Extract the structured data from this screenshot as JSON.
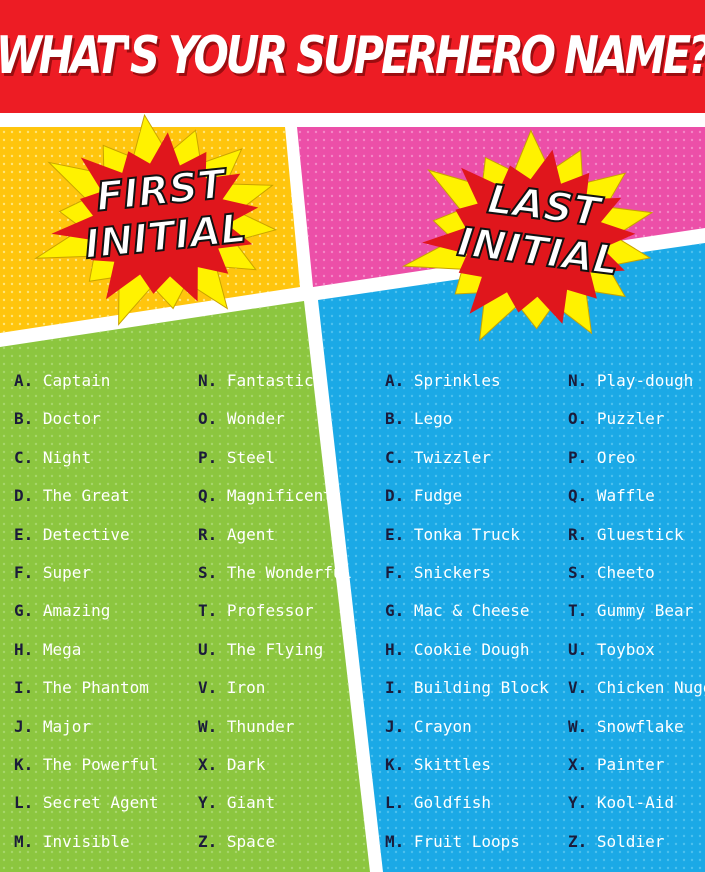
{
  "title": "WHAT'S YOUR SUPERHERO NAME?",
  "first_badge": {
    "line1": "FIRST",
    "line2": "INITIAL"
  },
  "last_badge": {
    "line1": "LAST",
    "line2": "INITIAL"
  },
  "colors": {
    "header": "#ed1c24",
    "first_panel": "#ffc50d",
    "last_panel": "#ec4fa8",
    "first_list_bg": "#8cc63f",
    "last_list_bg": "#1ba9e6",
    "burst_outer": "#fff200",
    "burst_inner": "#e0161c",
    "letter": "#1b1b3a"
  },
  "first_names": [
    {
      "letter": "A.",
      "word": "Captain"
    },
    {
      "letter": "B.",
      "word": "Doctor"
    },
    {
      "letter": "C.",
      "word": "Night"
    },
    {
      "letter": "D.",
      "word": "The Great"
    },
    {
      "letter": "E.",
      "word": "Detective"
    },
    {
      "letter": "F.",
      "word": "Super"
    },
    {
      "letter": "G.",
      "word": "Amazing"
    },
    {
      "letter": "H.",
      "word": "Mega"
    },
    {
      "letter": "I.",
      "word": "The Phantom"
    },
    {
      "letter": "J.",
      "word": "Major"
    },
    {
      "letter": "K.",
      "word": "The Powerful"
    },
    {
      "letter": "L.",
      "word": "Secret Agent"
    },
    {
      "letter": "M.",
      "word": "Invisible"
    },
    {
      "letter": "N.",
      "word": "Fantastic"
    },
    {
      "letter": "O.",
      "word": "Wonder"
    },
    {
      "letter": "P.",
      "word": "Steel"
    },
    {
      "letter": "Q.",
      "word": "Magnificent"
    },
    {
      "letter": "R.",
      "word": "Agent"
    },
    {
      "letter": "S.",
      "word": "The Wonderful"
    },
    {
      "letter": "T.",
      "word": "Professor"
    },
    {
      "letter": "U.",
      "word": "The Flying"
    },
    {
      "letter": "V.",
      "word": "Iron"
    },
    {
      "letter": "W.",
      "word": "Thunder"
    },
    {
      "letter": "X.",
      "word": "Dark"
    },
    {
      "letter": "Y.",
      "word": "Giant"
    },
    {
      "letter": "Z.",
      "word": "Space"
    }
  ],
  "last_names": [
    {
      "letter": "A.",
      "word": "Sprinkles"
    },
    {
      "letter": "B.",
      "word": "Lego"
    },
    {
      "letter": "C.",
      "word": "Twizzler"
    },
    {
      "letter": "D.",
      "word": "Fudge"
    },
    {
      "letter": "E.",
      "word": "Tonka Truck"
    },
    {
      "letter": "F.",
      "word": "Snickers"
    },
    {
      "letter": "G.",
      "word": "Mac & Cheese"
    },
    {
      "letter": "H.",
      "word": "Cookie Dough"
    },
    {
      "letter": "I.",
      "word": "Building Block"
    },
    {
      "letter": "J.",
      "word": "Crayon"
    },
    {
      "letter": "K.",
      "word": "Skittles"
    },
    {
      "letter": "L.",
      "word": "Goldfish"
    },
    {
      "letter": "M.",
      "word": "Fruit Loops"
    },
    {
      "letter": "N.",
      "word": "Play-dough"
    },
    {
      "letter": "O.",
      "word": "Puzzler"
    },
    {
      "letter": "P.",
      "word": "Oreo"
    },
    {
      "letter": "Q.",
      "word": "Waffle"
    },
    {
      "letter": "R.",
      "word": "Gluestick"
    },
    {
      "letter": "S.",
      "word": "Cheeto"
    },
    {
      "letter": "T.",
      "word": "Gummy Bear"
    },
    {
      "letter": "U.",
      "word": "Toybox"
    },
    {
      "letter": "V.",
      "word": "Chicken Nugget"
    },
    {
      "letter": "W.",
      "word": "Snowflake"
    },
    {
      "letter": "X.",
      "word": "Painter"
    },
    {
      "letter": "Y.",
      "word": "Kool-Aid"
    },
    {
      "letter": "Z.",
      "word": "Soldier"
    }
  ]
}
